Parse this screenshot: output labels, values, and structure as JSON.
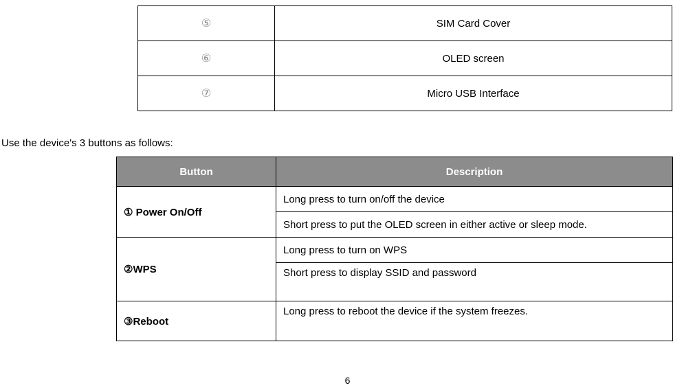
{
  "parts": [
    {
      "num": "⑤",
      "desc": "SIM Card Cover"
    },
    {
      "num": "⑥",
      "desc": "OLED screen"
    },
    {
      "num": "⑦",
      "desc": "Micro USB Interface"
    }
  ],
  "intro": "Use the device's 3 buttons as follows:",
  "buttons_table": {
    "headers": {
      "button": "Button",
      "description": "Description"
    },
    "rows": [
      {
        "button": "①  Power On/Off",
        "descriptions": [
          "Long press to turn on/off the device",
          "Short press to put the OLED screen in either active or sleep mode."
        ]
      },
      {
        "button": "②WPS",
        "descriptions": [
          "Long press to turn on WPS",
          "Short press to display SSID and password"
        ]
      },
      {
        "button": "③Reboot",
        "descriptions": [
          "Long press to reboot the device if the system freezes."
        ]
      }
    ]
  },
  "page_number": "6"
}
